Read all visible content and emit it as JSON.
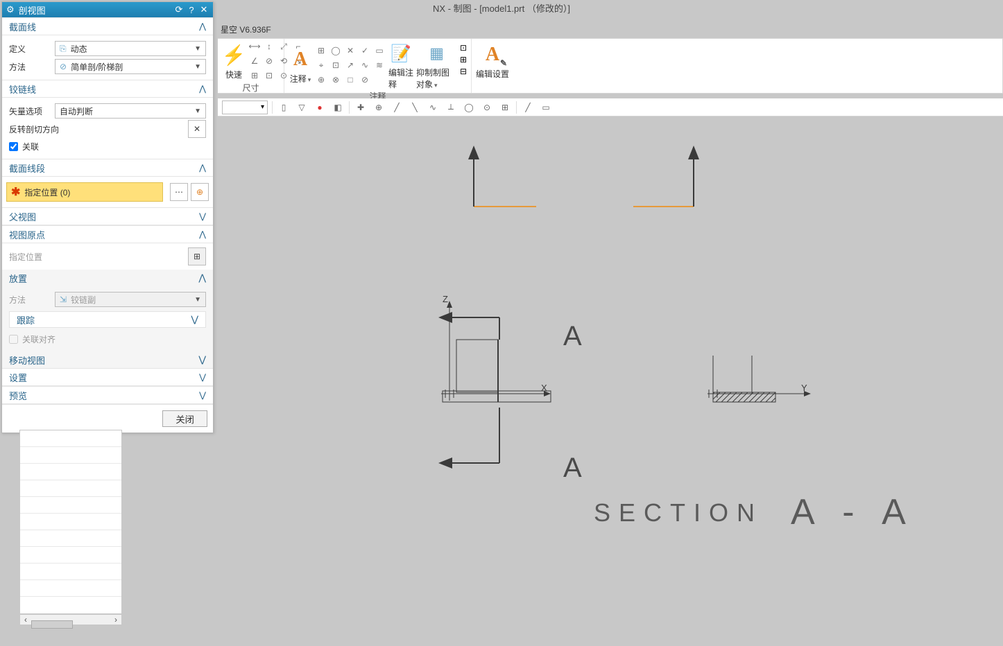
{
  "app": {
    "title": "NX - 制图 - [model1.prt （修改的）]"
  },
  "ribbon_tab": "星空 V6.936F",
  "ribbon": {
    "group_quick": "快速",
    "group_dim": "尺寸",
    "group_annot_big": "注释",
    "group_annot": "注释",
    "edit_annot": "编辑注释",
    "suppress_obj": "抑制制图对象",
    "edit_settings": "编辑设置"
  },
  "dialog": {
    "title": "剖视图",
    "sections": {
      "section_line": "截面线",
      "definition": "定义",
      "definition_value": "动态",
      "method": "方法",
      "method_value": "简单剖/阶梯剖",
      "hinge": "铰链线",
      "vector_option": "矢量选项",
      "vector_value": "自动判断",
      "reverse_cut": "反转剖切方向",
      "associative": "关联",
      "section_segments": "截面线段",
      "specify_location": "指定位置 (0)",
      "parent_view": "父视图",
      "view_origin": "视图原点",
      "specify_location2": "指定位置",
      "placement": "放置",
      "method2": "方法",
      "method2_value": "铰链副",
      "tracking": "跟踪",
      "assoc_align": "关联对齐",
      "move_view": "移动视图",
      "settings": "设置",
      "preview": "预览"
    },
    "close_btn": "关闭"
  },
  "canvas": {
    "label_a1": "A",
    "label_a2": "A",
    "section_label": "SECTION",
    "section_aa": "A - A",
    "axis_z": "Z",
    "axis_x": "X",
    "axis_y": "Y"
  }
}
